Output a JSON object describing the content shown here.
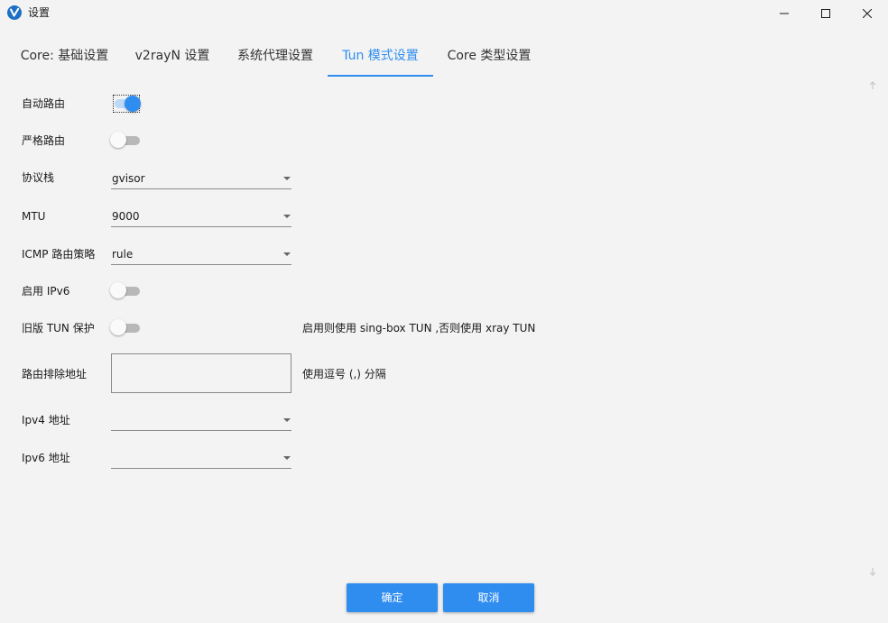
{
  "window": {
    "title": "设置",
    "controls": {
      "minimize": "minimize-icon",
      "maximize": "maximize-icon",
      "close": "close-icon"
    }
  },
  "tabs": [
    {
      "label": "Core: 基础设置",
      "active": false
    },
    {
      "label": "v2rayN 设置",
      "active": false
    },
    {
      "label": "系统代理设置",
      "active": false
    },
    {
      "label": "Tun 模式设置",
      "active": true
    },
    {
      "label": "Core 类型设置",
      "active": false
    }
  ],
  "tun": {
    "auto_route": {
      "label": "自动路由",
      "on": true
    },
    "strict_route": {
      "label": "严格路由",
      "on": false
    },
    "stack": {
      "label": "协议栈",
      "value": "gvisor"
    },
    "mtu": {
      "label": "MTU",
      "value": "9000"
    },
    "icmp_routing": {
      "label": "ICMP 路由策略",
      "value": "rule"
    },
    "enable_ipv6": {
      "label": "启用 IPv6",
      "on": false
    },
    "legacy_protect": {
      "label": "旧版 TUN 保护",
      "on": false,
      "hint": "启用则使用 sing-box TUN ,否则使用 xray TUN"
    },
    "route_exclude": {
      "label": "路由排除地址",
      "value": "",
      "hint": "使用逗号 (,) 分隔"
    },
    "ipv4_address": {
      "label": "Ipv4 地址",
      "value": ""
    },
    "ipv6_address": {
      "label": "Ipv6 地址",
      "value": ""
    }
  },
  "buttons": {
    "ok": "确定",
    "cancel": "取消"
  },
  "colors": {
    "accent": "#2f8df0",
    "background": "#f3f3f3",
    "toggle_off": "#b8b8b8"
  }
}
